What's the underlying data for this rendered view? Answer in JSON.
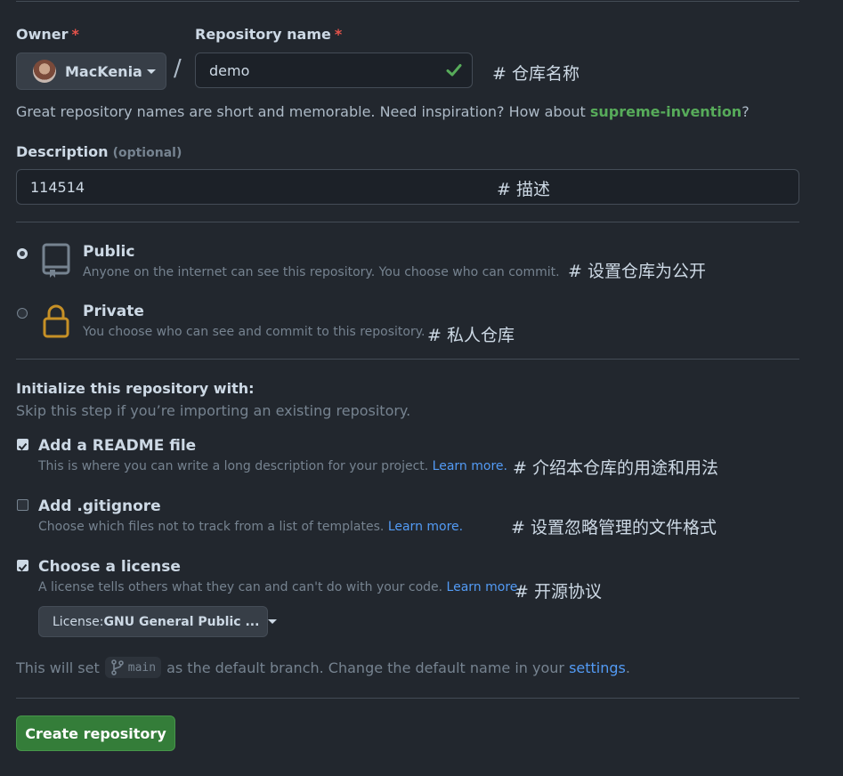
{
  "owner": {
    "label": "Owner",
    "required_mark": "*",
    "value": "MacKenia"
  },
  "separator": "/",
  "repo_name": {
    "label": "Repository name",
    "required_mark": "*",
    "value": "demo",
    "annotation": "# 仓库名称"
  },
  "hint": {
    "prefix": "Great repository names are short and memorable. Need inspiration? How about ",
    "suggestion": "supreme-invention",
    "suffix": "?"
  },
  "description": {
    "label": "Description",
    "optional": "(optional)",
    "value": "114514",
    "annotation": "# 描述"
  },
  "visibility": {
    "public": {
      "title": "Public",
      "desc": "Anyone on the internet can see this repository. You choose who can commit.",
      "annotation": "# 设置仓库为公开",
      "selected": true
    },
    "private": {
      "title": "Private",
      "desc": "You choose who can see and commit to this repository.",
      "annotation": "# 私人仓库",
      "selected": false
    }
  },
  "init": {
    "title": "Initialize this repository with:",
    "subtitle": "Skip this step if you’re importing an existing repository.",
    "readme": {
      "title": "Add a README file",
      "desc": "This is where you can write a long description for your project.",
      "link": "Learn more.",
      "annotation": "# 介绍本仓库的用途和用法",
      "checked": true
    },
    "gitignore": {
      "title": "Add .gitignore",
      "desc": "Choose which files not to track from a list of templates.",
      "link": "Learn more.",
      "annotation": "# 设置忽略管理的文件格式",
      "checked": false
    },
    "license": {
      "title": "Choose a license",
      "desc": "A license tells others what they can and can't do with your code.",
      "link": "Learn more.",
      "annotation": "# 开源协议",
      "checked": true,
      "select_prefix": "License: ",
      "select_value": "GNU General Public ..."
    }
  },
  "branch": {
    "prefix": "This will set",
    "name": "main",
    "middle": "as the default branch. Change the default name in your",
    "link": "settings",
    "suffix": "."
  },
  "create_button": "Create repository",
  "colors": {
    "background": "#22272e",
    "accent_green": "#347d39",
    "link_blue": "#539bf5",
    "success_green": "#57ab5a",
    "private_icon": "#c69026"
  },
  "icons": [
    "avatar",
    "caret-down-icon",
    "check-icon",
    "repo-icon",
    "lock-icon",
    "git-branch-icon"
  ]
}
